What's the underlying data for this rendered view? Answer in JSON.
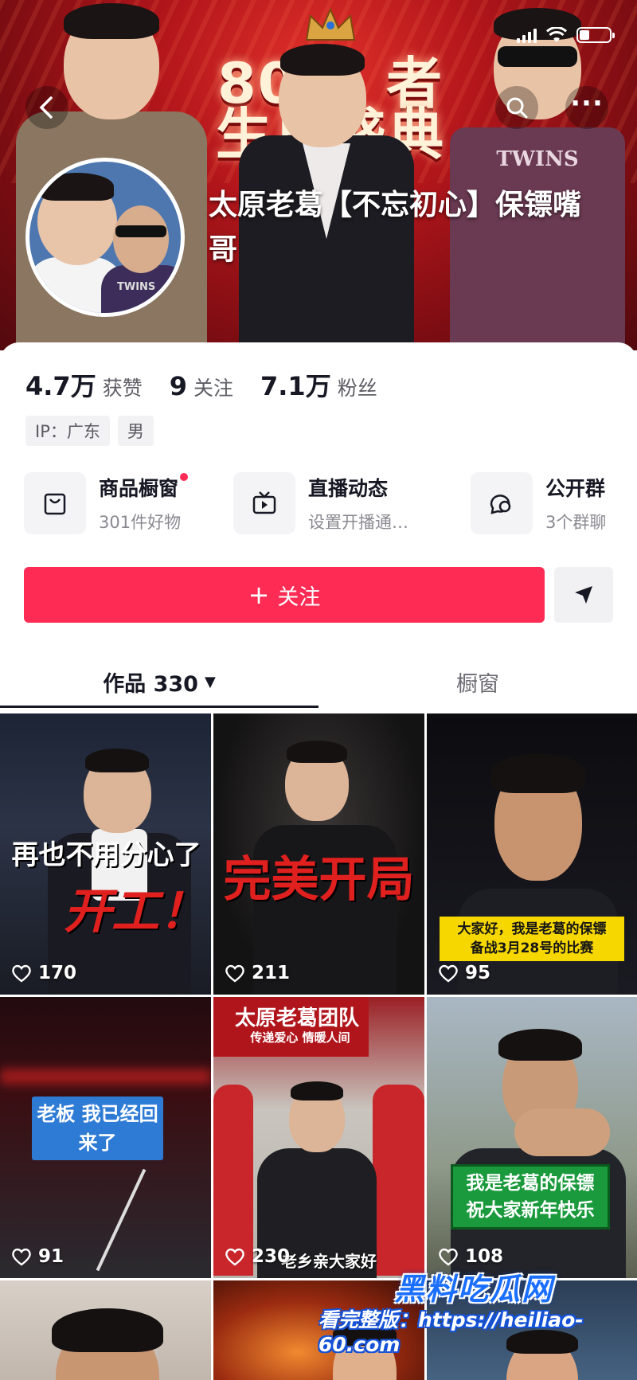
{
  "header": {
    "banner_text_line1": "808",
    "banner_text_line1b": "者",
    "banner_text_line2": "生日盛典",
    "shirt_logo": "TWINS",
    "avatar_shirt_logo": "TWINS",
    "username": "太原老葛【不忘初心】保镖嘴哥",
    "back_icon": "chevron-left-icon",
    "search_icon": "search-icon",
    "more_icon": "more-dots-icon",
    "more_label": "···"
  },
  "stats": {
    "likes_value": "4.7万",
    "likes_label": "获赞",
    "following_value": "9",
    "following_label": "关注",
    "followers_value": "7.1万",
    "followers_label": "粉丝"
  },
  "tags": {
    "ip": "IP：广东",
    "gender": "男"
  },
  "services": [
    {
      "title": "商品橱窗",
      "subtitle": "301件好物",
      "icon": "shopping-bag-icon",
      "has_dot": true
    },
    {
      "title": "直播动态",
      "subtitle": "设置开播通…",
      "icon": "live-tv-icon",
      "has_dot": false
    },
    {
      "title": "公开群",
      "subtitle": "3个群聊",
      "icon": "group-chat-icon",
      "has_dot": false
    }
  ],
  "actions": {
    "follow_label": "关注",
    "follow_plus": "+",
    "share_icon": "send-icon"
  },
  "tabs": {
    "works_label": "作品 330",
    "works_caret": "▼",
    "window_label": "橱窗"
  },
  "videos": [
    {
      "likes": "170",
      "caption_line1": "再也不用分心了",
      "caption_line2": "开工！"
    },
    {
      "likes": "211",
      "caption": "完美开局"
    },
    {
      "likes": "95",
      "caption_line1": "大家好，我是老葛的保镖",
      "caption_line2": "备战3月28号的比赛"
    },
    {
      "likes": "91",
      "caption": "老板 我已经回来了"
    },
    {
      "likes": "230",
      "caption_top": "太原老葛团队",
      "caption_sub": "传递爱心 情暖人间",
      "caption_bottom": "老乡亲大家好"
    },
    {
      "likes": "108",
      "caption_line1": "我是老葛的保镖",
      "caption_line2": "祝大家新年快乐"
    },
    {
      "likes": ""
    },
    {
      "likes": ""
    },
    {
      "likes": ""
    }
  ],
  "watermark": {
    "brand": "黑料吃瓜网",
    "text": "看完整版：https://heiliao-60.com"
  },
  "colors": {
    "accent": "#fe2c55",
    "text_primary": "#161823",
    "text_secondary": "#8a8a92"
  }
}
